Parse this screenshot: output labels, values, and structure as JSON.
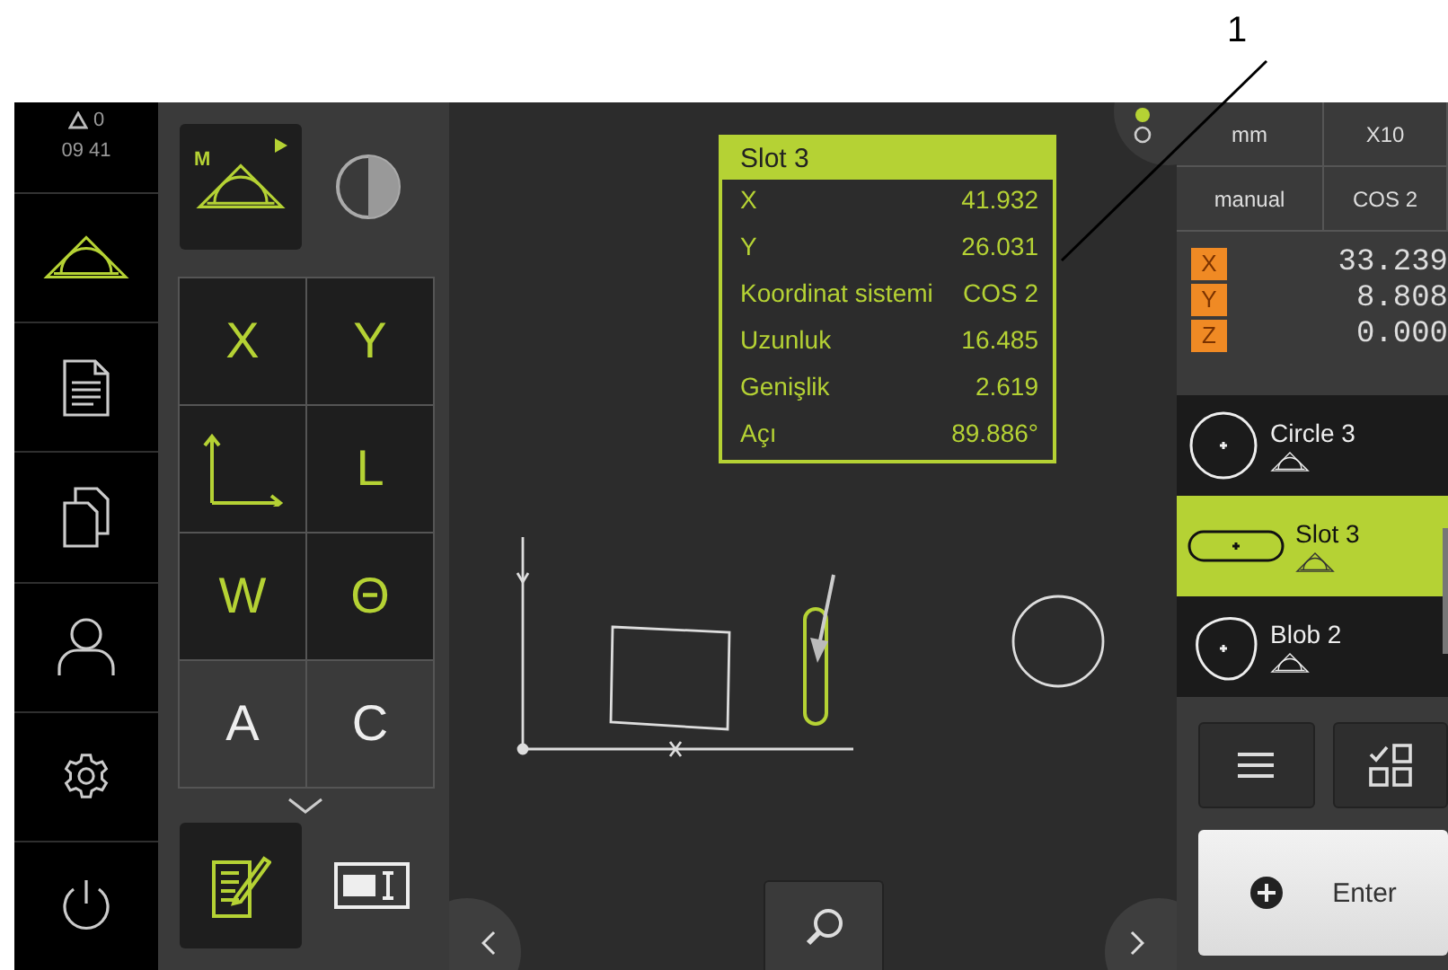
{
  "callout": "1",
  "mode_letter": "M",
  "status": {
    "warnings": "0",
    "time": "09 41"
  },
  "sidebar": {
    "items": [
      {
        "kind": "measure",
        "selected": true
      },
      {
        "kind": "report",
        "selected": false
      },
      {
        "kind": "files",
        "selected": false
      },
      {
        "kind": "user",
        "selected": false
      },
      {
        "kind": "settings",
        "selected": false
      },
      {
        "kind": "power",
        "selected": false
      }
    ]
  },
  "tools": {
    "buttons": [
      {
        "label": "X",
        "enabled": true
      },
      {
        "label": "Y",
        "enabled": true
      },
      {
        "kind": "axes",
        "enabled": true
      },
      {
        "label": "L",
        "enabled": true
      },
      {
        "label": "W",
        "enabled": true
      },
      {
        "label": "Θ",
        "enabled": true
      },
      {
        "label": "A",
        "enabled": false
      },
      {
        "label": "C",
        "enabled": false
      }
    ]
  },
  "popup": {
    "title": "Slot 3",
    "rows": [
      {
        "label": "X",
        "value": "41.932"
      },
      {
        "label": "Y",
        "value": "26.031"
      },
      {
        "label": "Koordinat sistemi",
        "value": "COS 2"
      },
      {
        "label": "Uzunluk",
        "value": "16.485"
      },
      {
        "label": "Genişlik",
        "value": "2.619"
      },
      {
        "label": "Açı",
        "value": "89.886°"
      }
    ]
  },
  "settings": [
    "mm",
    "X10",
    "manual",
    "COS 2"
  ],
  "positions": [
    {
      "axis": "X",
      "value": "33.239"
    },
    {
      "axis": "Y",
      "value": "8.808"
    },
    {
      "axis": "Z",
      "value": "0.000"
    }
  ],
  "features": [
    {
      "name": "Circle 3",
      "kind": "circle",
      "selected": false
    },
    {
      "name": "Slot 3",
      "kind": "slot",
      "selected": true
    },
    {
      "name": "Blob 2",
      "kind": "blob",
      "selected": false
    }
  ],
  "enter_button": "Enter"
}
